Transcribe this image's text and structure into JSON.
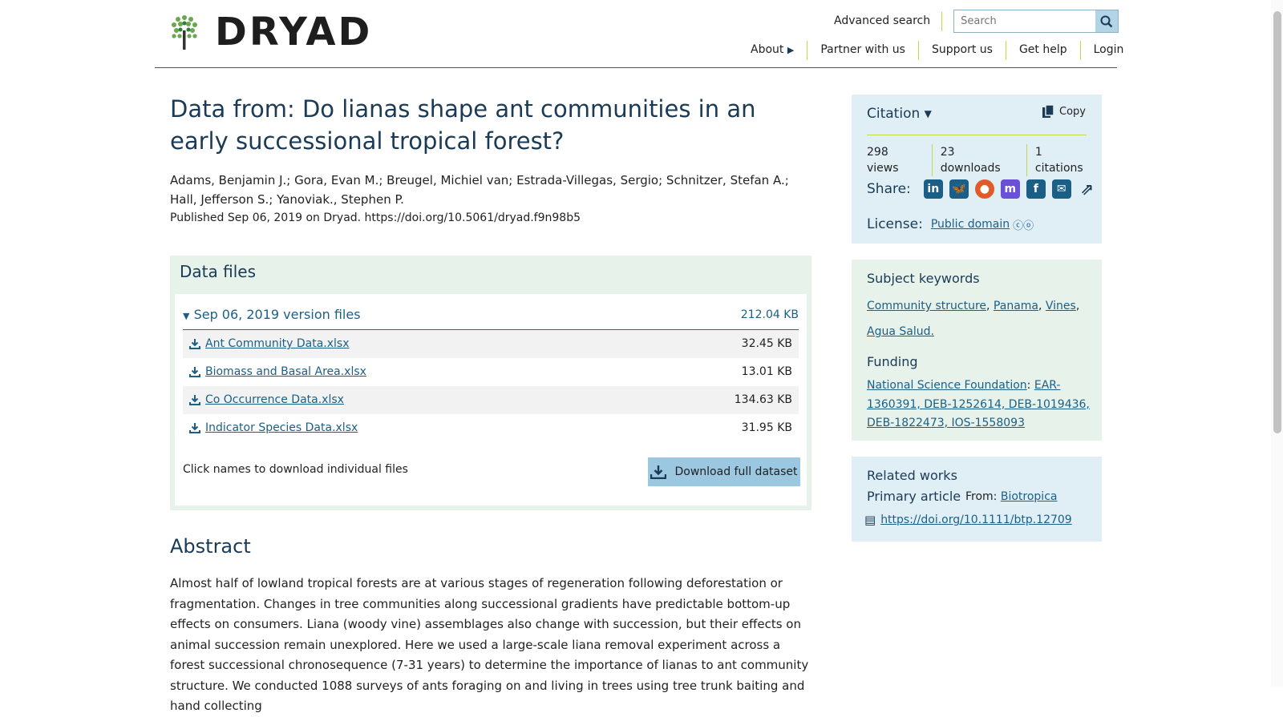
{
  "header": {
    "logo_text": "DRYAD",
    "advanced_search": "Advanced search",
    "search_placeholder": "Search",
    "nav": {
      "about": "About",
      "partner": "Partner with us",
      "support": "Support us",
      "help": "Get help",
      "login": "Login"
    }
  },
  "dataset": {
    "title": "Data from: Do lianas shape ant communities in an early successional tropical forest?",
    "authors": "Adams, Benjamin J.; Gora, Evan M.; Breugel, Michiel van; Estrada-Villegas, Sergio; Schnitzer, Stefan A.; Hall, Jefferson S.; Yanoviak., Stephen P.",
    "published": "Published Sep 06, 2019 on Dryad. https://doi.org/10.5061/dryad.f9n98b5"
  },
  "data_files": {
    "heading": "Data files",
    "version_label": "Sep 06, 2019 version files",
    "version_size": "212.04 KB",
    "files": [
      {
        "name": "Ant Community Data.xlsx",
        "size": "32.45 KB"
      },
      {
        "name": "Biomass and Basal Area.xlsx",
        "size": "13.01 KB"
      },
      {
        "name": "Co Occurrence Data.xlsx",
        "size": "134.63 KB"
      },
      {
        "name": "Indicator Species Data.xlsx",
        "size": "31.95 KB"
      }
    ],
    "hint": "Click names to download individual files",
    "download_full": "Download full dataset"
  },
  "abstract": {
    "heading": "Abstract",
    "text": "Almost half of lowland tropical forests are at various stages of regeneration following deforestation or fragmentation. Changes in tree communities along successional gradients have predictable bottom-up effects on consumers. Liana (woody vine) assemblages also change with succession, but their effects on animal succession remain unexplored. Here we used a large-scale liana removal experiment across a forest successional chronosequence (7-31 years) to determine the importance of lianas to ant community structure. We conducted 1088 surveys of ants foraging on and living in trees using tree trunk baiting and hand collecting"
  },
  "citation": {
    "label": "Citation",
    "copy": "Copy",
    "views": "298 views",
    "downloads": "23 downloads",
    "citations": "1 citations",
    "share_label": "Share:",
    "share_icons": [
      "linkedin-icon",
      "bluesky-icon",
      "reddit-icon",
      "mastodon-icon",
      "facebook-icon",
      "email-icon",
      "share-icon"
    ],
    "license_label": "License:",
    "license_link": "Public domain"
  },
  "keywords": {
    "heading": "Subject keywords",
    "items": [
      "Community structure",
      "Panama",
      "Vines",
      "Agua Salud."
    ],
    "funding_heading": "Funding",
    "funder": "National Science Foundation",
    "grants": "EAR-1360391, DEB-1252614, DEB-1019436, DEB-1822473, IOS-1558093"
  },
  "related": {
    "heading": "Related works",
    "primary": "Primary article",
    "from_label": "From:",
    "journal": "Biotropica",
    "doi": "https://doi.org/10.1111/btp.12709"
  },
  "colors": {
    "link": "#1b5f87",
    "heading": "#1a3a55",
    "accent_rule": "#c7d64c",
    "green_panel": "#e6f2ea",
    "blue_panel": "#e0eff6"
  }
}
